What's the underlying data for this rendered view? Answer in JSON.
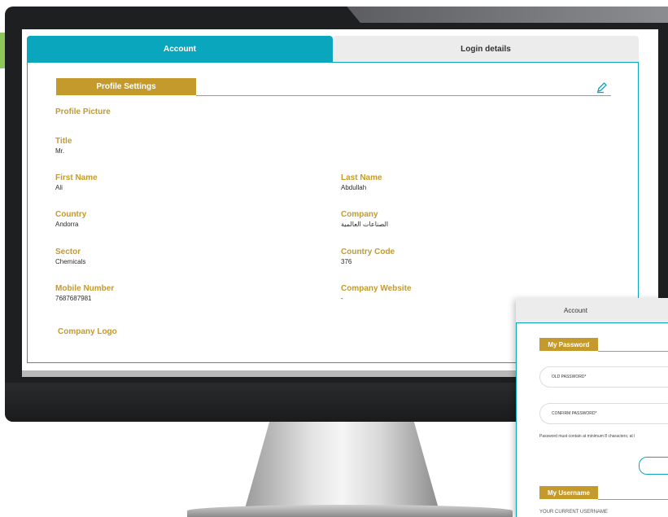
{
  "tabs": {
    "account": "Account",
    "login_details": "Login details"
  },
  "section": {
    "title": "Profile Settings"
  },
  "profile": {
    "picture_label": "Profile Picture",
    "title_label": "Title",
    "title_value": "Mr.",
    "first_name_label": "First Name",
    "first_name_value": "Ali",
    "last_name_label": "Last Name",
    "last_name_value": "Abdullah",
    "country_label": "Country",
    "country_value": "Andorra",
    "company_label": "Company",
    "company_value": "الصناعات العالمية",
    "sector_label": "Sector",
    "sector_value": "Chemicals",
    "country_code_label": "Country Code",
    "country_code_value": "376",
    "mobile_label": "Mobile Number",
    "mobile_value": "7687687981",
    "website_label": "Company Website",
    "website_value": "-",
    "logo_label": "Company Logo"
  },
  "overlay": {
    "tab_label": "Account",
    "password_section": "My Password",
    "old_password_placeholder": "OLD PASSWORD*",
    "confirm_password_placeholder": "CONFIRM PASSWORD*",
    "hint": "Password must contain at minimum 8 characters; at l",
    "username_section": "My Username",
    "username_text": "YOUR CURRENT USERNAME"
  },
  "colors": {
    "accent_teal": "#0aa6be",
    "accent_gold": "#c49a2c"
  },
  "icons": {
    "edit": "pencil-icon"
  }
}
